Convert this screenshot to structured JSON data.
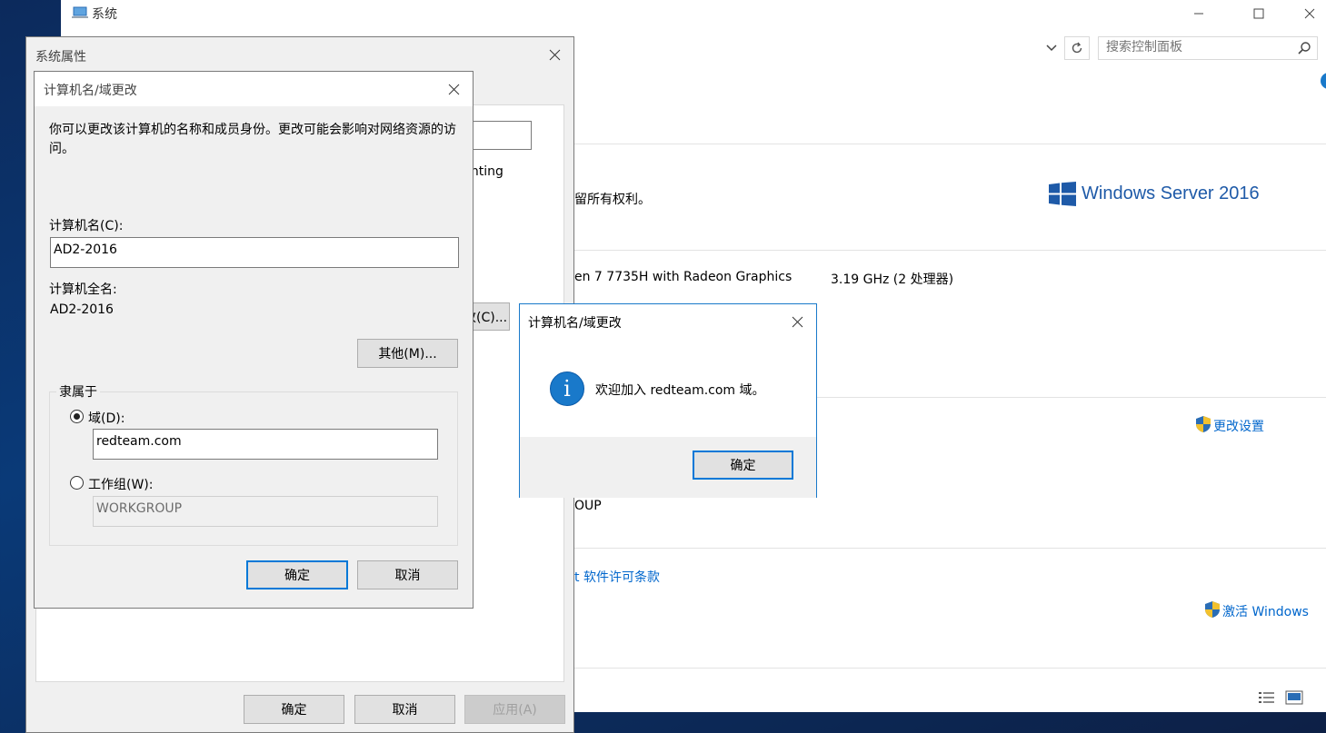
{
  "system_window": {
    "title": "系统",
    "search_placeholder": "搜索控制面板",
    "copyright_fragment": "留所有权利。",
    "brand": "Windows Server 2016",
    "brand_mark": "®",
    "processor": "en 7 7735H with Radeon Graphics",
    "processor_speed": "3.19 GHz  (2 处理器)",
    "change_settings": "更改设置",
    "workgroup_fragment": "OUP",
    "license_link": "t 软件许可条款",
    "activate_windows": "激活 Windows"
  },
  "system_properties": {
    "title": "系统属性",
    "accounting_fragment": "unting",
    "change_button_fragment": "改(C)...",
    "ok": "确定",
    "cancel": "取消",
    "apply": "应用(A)"
  },
  "computer_name_dialog": {
    "title": "计算机名/域更改",
    "description": "你可以更改该计算机的名称和成员身份。更改可能会影响对网络资源的访问。",
    "computer_name_label": "计算机名(C):",
    "computer_name_value": "AD2-2016",
    "full_name_label": "计算机全名:",
    "full_name_value": "AD2-2016",
    "more_button": "其他(M)...",
    "member_of_legend": "隶属于",
    "domain_radio_label": "域(D):",
    "domain_value": "redteam.com",
    "workgroup_radio_label": "工作组(W):",
    "workgroup_value": "WORKGROUP",
    "ok": "确定",
    "cancel": "取消"
  },
  "welcome_message": {
    "title": "计算机名/域更改",
    "message": "欢迎加入 redteam.com 域。",
    "ok": "确定",
    "icon": "info-icon"
  },
  "colors": {
    "accent": "#0078d7",
    "link": "#0066cc",
    "brand_blue": "#1e5aa8",
    "desktop": "#0a3a78"
  }
}
